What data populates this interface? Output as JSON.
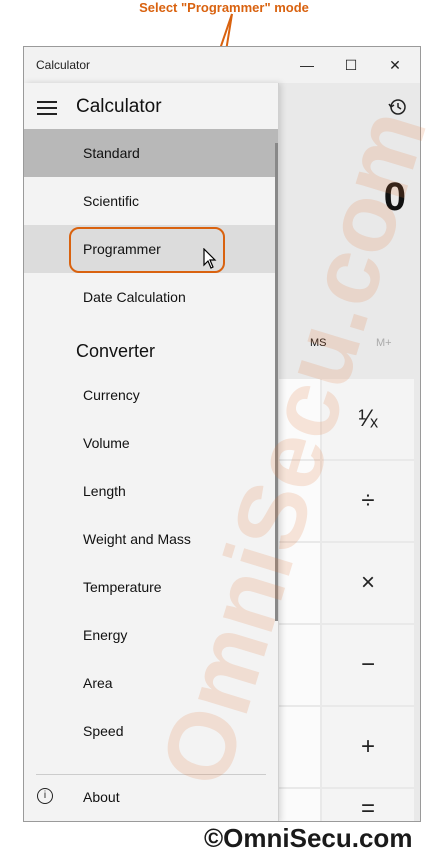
{
  "annotation": {
    "instruction": "Select \"Programmer\" mode"
  },
  "window": {
    "title": "Calculator",
    "minimize": "—",
    "maximize": "☐",
    "close": "✕"
  },
  "calculator": {
    "display_value": "0",
    "memory": {
      "ms": "MS",
      "mplus": "M+"
    },
    "keys": {
      "reciprocal": "¹⁄ₓ",
      "divide": "÷",
      "multiply": "×",
      "minus": "−",
      "plus": "+",
      "equals": "="
    }
  },
  "drawer": {
    "title": "Calculator",
    "calculator_items": [
      {
        "label": "Standard"
      },
      {
        "label": "Scientific"
      },
      {
        "label": "Programmer"
      },
      {
        "label": "Date Calculation"
      }
    ],
    "converter_header": "Converter",
    "converter_items": [
      {
        "label": "Currency"
      },
      {
        "label": "Volume"
      },
      {
        "label": "Length"
      },
      {
        "label": "Weight and Mass"
      },
      {
        "label": "Temperature"
      },
      {
        "label": "Energy"
      },
      {
        "label": "Area"
      },
      {
        "label": "Speed"
      }
    ],
    "about_label": "About"
  },
  "watermark": {
    "text": "OmniSecu.com"
  },
  "copyright": {
    "text": "©OmniSecu.com"
  },
  "colors": {
    "annotation": "#d9620f",
    "selected": "#b8b8b8",
    "hover": "#dcdcdc"
  }
}
